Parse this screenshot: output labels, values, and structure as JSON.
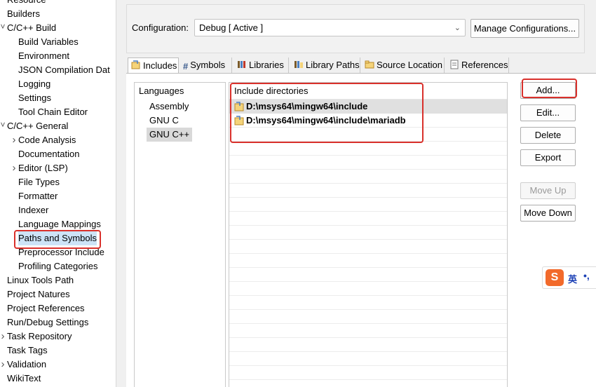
{
  "tree": {
    "items": [
      {
        "label": "Resource",
        "indent": 1,
        "twisty": ""
      },
      {
        "label": "Builders",
        "indent": 1,
        "twisty": ""
      },
      {
        "label": "C/C++ Build",
        "indent": 1,
        "twisty": "expanded"
      },
      {
        "label": "Build Variables",
        "indent": 2,
        "twisty": ""
      },
      {
        "label": "Environment",
        "indent": 2,
        "twisty": ""
      },
      {
        "label": "JSON Compilation Dat",
        "indent": 2,
        "twisty": ""
      },
      {
        "label": "Logging",
        "indent": 2,
        "twisty": ""
      },
      {
        "label": "Settings",
        "indent": 2,
        "twisty": ""
      },
      {
        "label": "Tool Chain Editor",
        "indent": 2,
        "twisty": ""
      },
      {
        "label": "C/C++ General",
        "indent": 1,
        "twisty": "expanded"
      },
      {
        "label": "Code Analysis",
        "indent": 2,
        "twisty": "collapsed"
      },
      {
        "label": "Documentation",
        "indent": 2,
        "twisty": ""
      },
      {
        "label": "Editor (LSP)",
        "indent": 2,
        "twisty": "collapsed"
      },
      {
        "label": "File Types",
        "indent": 2,
        "twisty": ""
      },
      {
        "label": "Formatter",
        "indent": 2,
        "twisty": ""
      },
      {
        "label": "Indexer",
        "indent": 2,
        "twisty": ""
      },
      {
        "label": "Language Mappings",
        "indent": 2,
        "twisty": ""
      },
      {
        "label": "Paths and Symbols",
        "indent": 2,
        "twisty": "",
        "selected": true
      },
      {
        "label": "Preprocessor Include",
        "indent": 2,
        "twisty": ""
      },
      {
        "label": "Profiling Categories",
        "indent": 2,
        "twisty": ""
      },
      {
        "label": "Linux Tools Path",
        "indent": 1,
        "twisty": ""
      },
      {
        "label": "Project Natures",
        "indent": 1,
        "twisty": ""
      },
      {
        "label": "Project References",
        "indent": 1,
        "twisty": ""
      },
      {
        "label": "Run/Debug Settings",
        "indent": 1,
        "twisty": ""
      },
      {
        "label": "Task Repository",
        "indent": 1,
        "twisty": "collapsed"
      },
      {
        "label": "Task Tags",
        "indent": 1,
        "twisty": ""
      },
      {
        "label": "Validation",
        "indent": 1,
        "twisty": "collapsed"
      },
      {
        "label": "WikiText",
        "indent": 1,
        "twisty": ""
      }
    ]
  },
  "config": {
    "label": "Configuration:",
    "value": "Debug  [ Active ]",
    "manage_label": "Manage Configurations..."
  },
  "tabs": [
    {
      "label": "Includes",
      "icon": "includes-icon",
      "active": true
    },
    {
      "label": "Symbols",
      "icon": "hash-icon"
    },
    {
      "label": "Libraries",
      "icon": "libraries-icon"
    },
    {
      "label": "Library Paths",
      "icon": "library-paths-icon"
    },
    {
      "label": "Source Location",
      "icon": "source-location-icon"
    },
    {
      "label": "References",
      "icon": "references-icon"
    }
  ],
  "languages": {
    "header": "Languages",
    "items": [
      {
        "label": "Assembly"
      },
      {
        "label": "GNU C"
      },
      {
        "label": "GNU C++",
        "selected": true
      }
    ]
  },
  "includes": {
    "header": "Include directories",
    "rows": [
      {
        "path": "D:\\msys64\\mingw64\\include",
        "selected": true
      },
      {
        "path": "D:\\msys64\\mingw64\\include\\mariadb"
      }
    ]
  },
  "buttons": {
    "add": "Add...",
    "edit": "Edit...",
    "delete": "Delete",
    "export": "Export",
    "move_up": "Move Up",
    "move_down": "Move Down"
  },
  "ime": {
    "logo": "S",
    "mode": "英",
    "punct": "•,"
  },
  "colors": {
    "annotation_red": "#d9302b",
    "selection_gray": "#d9d9d9",
    "ime_orange": "#f26a2b"
  }
}
